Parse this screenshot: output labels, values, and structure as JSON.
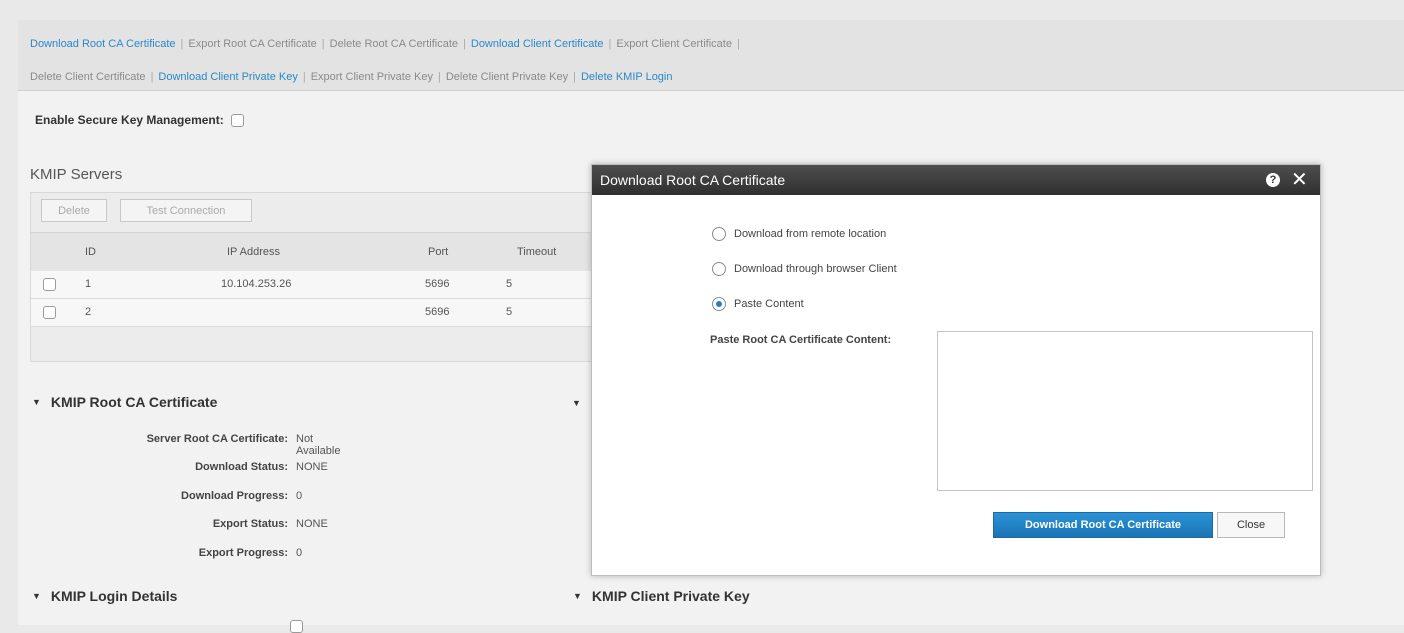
{
  "actions": {
    "row1": [
      {
        "label": "Download Root CA Certificate",
        "enabled": true
      },
      {
        "label": "Export Root CA Certificate",
        "enabled": false
      },
      {
        "label": "Delete Root CA Certificate",
        "enabled": false
      },
      {
        "label": "Download Client Certificate",
        "enabled": true
      },
      {
        "label": "Export Client Certificate",
        "enabled": false
      }
    ],
    "row2": [
      {
        "label": "Delete Client Certificate",
        "enabled": false
      },
      {
        "label": "Download Client Private Key",
        "enabled": true
      },
      {
        "label": "Export Client Private Key",
        "enabled": false
      },
      {
        "label": "Delete Client Private Key",
        "enabled": false
      },
      {
        "label": "Delete KMIP Login",
        "enabled": true
      }
    ],
    "separator": "|"
  },
  "secure_key": {
    "label": "Enable Secure Key Management:",
    "checked": false
  },
  "kmip_servers": {
    "title": "KMIP Servers",
    "buttons": {
      "delete": "Delete",
      "test": "Test Connection"
    },
    "columns": {
      "id": "ID",
      "ip": "IP Address",
      "port": "Port",
      "timeout": "Timeout"
    },
    "rows": [
      {
        "id": "1",
        "ip": "10.104.253.26",
        "port": "5696",
        "timeout": "5"
      },
      {
        "id": "2",
        "ip": "",
        "port": "5696",
        "timeout": "5"
      }
    ]
  },
  "root_ca_section": {
    "title": "KMIP Root CA Certificate",
    "fields": [
      {
        "label": "Server Root CA Certificate:",
        "value": "Not Available"
      },
      {
        "label": "Download Status:",
        "value": "NONE"
      },
      {
        "label": "Download Progress:",
        "value": "0"
      },
      {
        "label": "Export Status:",
        "value": "NONE"
      },
      {
        "label": "Export Progress:",
        "value": "0"
      }
    ]
  },
  "login_section": {
    "title": "KMIP Login Details"
  },
  "private_key_section": {
    "title": "KMIP Client Private Key"
  },
  "collapse_glyph": "▼",
  "dialog": {
    "title": "Download Root CA Certificate",
    "help_glyph": "?",
    "close_glyph": "✕",
    "options": [
      {
        "label": "Download from remote location",
        "checked": false
      },
      {
        "label": "Download through browser Client",
        "checked": false
      },
      {
        "label": "Paste Content",
        "checked": true
      }
    ],
    "paste_label": "Paste Root CA Certificate Content:",
    "paste_value": "",
    "primary_button": "Download Root CA Certificate",
    "secondary_button": "Close"
  },
  "colors": {
    "link": "#2a88c8",
    "primary": "#1b74b6",
    "header_dark": "#3a3a3a"
  }
}
